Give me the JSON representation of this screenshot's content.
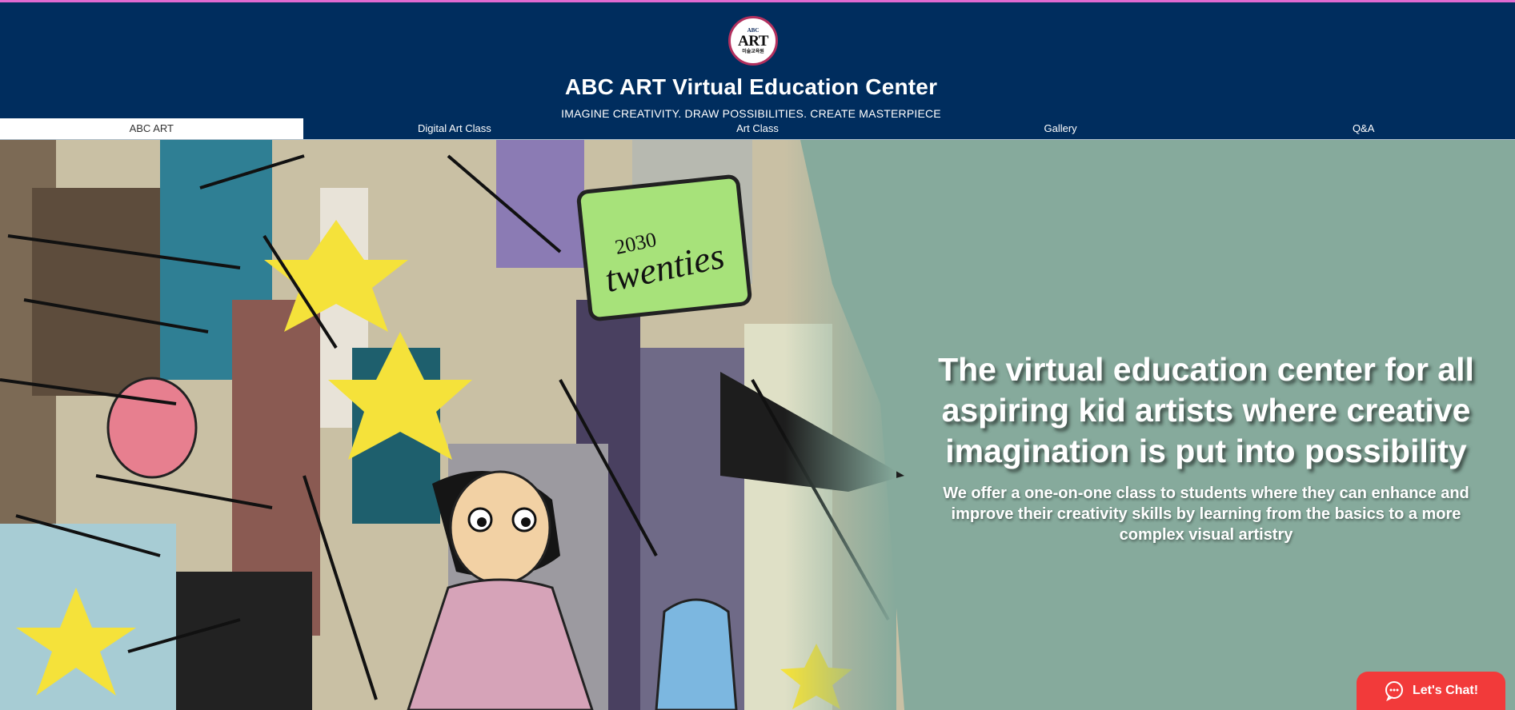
{
  "header": {
    "logo": {
      "small_text": "ABC",
      "main_text": "ART",
      "korean_text": "미술교육원"
    },
    "title": "ABC ART Virtual Education Center",
    "tagline": "IMAGINE CREATIVITY. DRAW POSSIBILITIES. CREATE MASTERPIECE"
  },
  "nav": {
    "items": [
      {
        "label": "ABC ART",
        "active": true
      },
      {
        "label": "Digital Art Class",
        "active": false
      },
      {
        "label": "Art Class",
        "active": false
      },
      {
        "label": "Gallery",
        "active": false
      },
      {
        "label": "Q&A",
        "active": false
      }
    ]
  },
  "hero": {
    "image_sign_year": "2030",
    "image_sign_word": "twenties",
    "headline": "The virtual education center for all aspiring kid artists where creative imagination is put into possibility",
    "subtext": "We offer a one-on-one class to students where they can enhance and improve their creativity skills by learning from the basics to a more complex visual artistry"
  },
  "chat": {
    "label": "Let's Chat!",
    "icon": "chat-bubble-icon"
  },
  "colors": {
    "header_bg": "#002d5e",
    "accent_strip": "#e06ad0",
    "hero_bg": "#86aa9c",
    "chat_button": "#f23a3a"
  }
}
